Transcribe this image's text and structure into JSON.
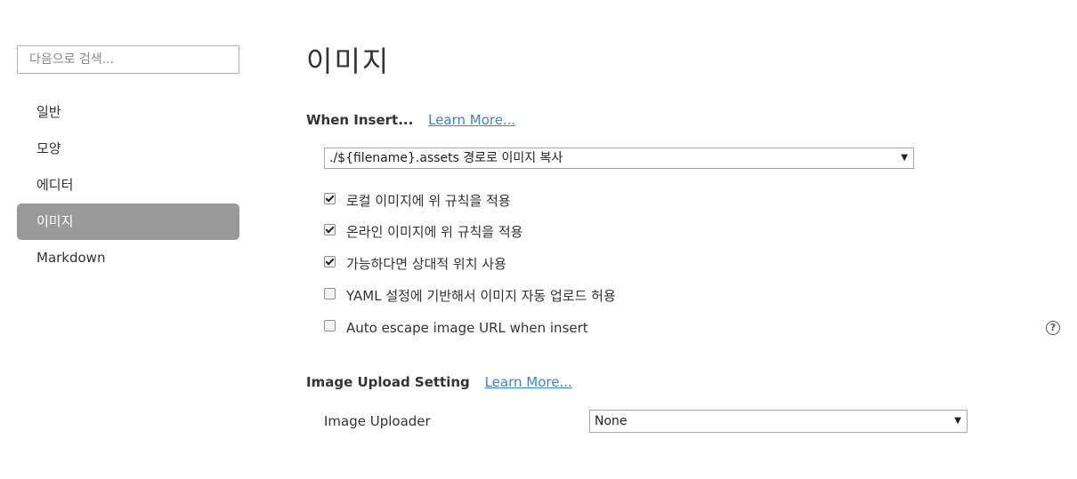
{
  "sidebar": {
    "search_placeholder": "다음으로 검색...",
    "items": [
      {
        "label": "일반",
        "active": false
      },
      {
        "label": "모양",
        "active": false
      },
      {
        "label": "에디터",
        "active": false
      },
      {
        "label": "이미지",
        "active": true
      },
      {
        "label": "Markdown",
        "active": false
      }
    ]
  },
  "main": {
    "title": "이미지",
    "when_insert": {
      "label": "When Insert...",
      "learn_more": "Learn More...",
      "select_value": "./${filename}.assets 경로로 이미지 복사",
      "options": [
        {
          "label": "로컬 이미지에 위 규칙을 적용",
          "checked": true
        },
        {
          "label": "온라인 이미지에 위 규칙을 적용",
          "checked": true
        },
        {
          "label": "가능하다면 상대적 위치 사용",
          "checked": true
        },
        {
          "label": "YAML 설정에 기반해서 이미지 자동 업로드 허용",
          "checked": false
        },
        {
          "label": "Auto escape image URL when insert",
          "checked": false
        }
      ],
      "help_icon": "question-circle-icon"
    },
    "upload": {
      "label": "Image Upload Setting",
      "learn_more": "Learn More...",
      "uploader_label": "Image Uploader",
      "uploader_value": "None"
    }
  },
  "icons": {
    "dropdown_arrow": "▼",
    "help": "?"
  }
}
